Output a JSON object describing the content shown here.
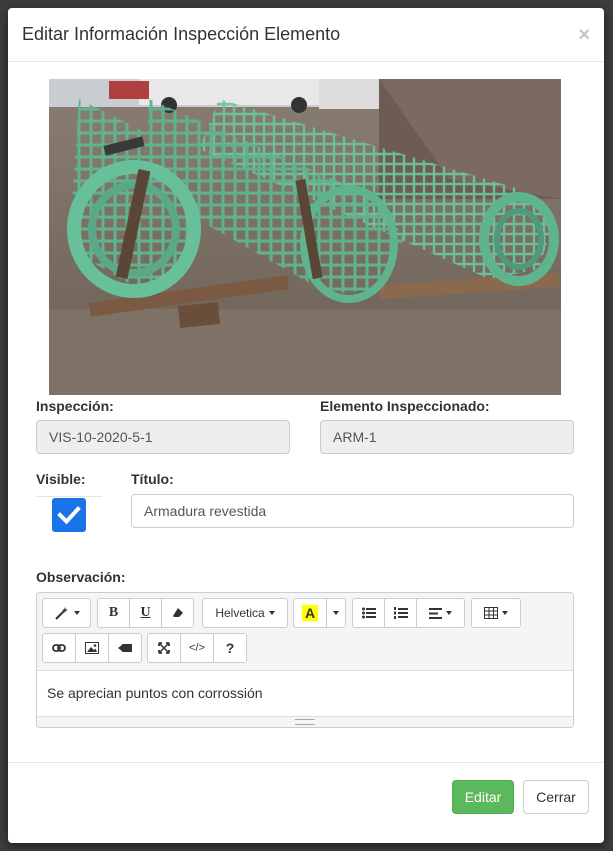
{
  "modal": {
    "title": "Editar Información Inspección Elemento",
    "close_symbol": "×"
  },
  "form": {
    "inspeccion_label": "Inspección:",
    "inspeccion_value": "VIS-10-2020-5-1",
    "elemento_label": "Elemento Inspeccionado:",
    "elemento_value": "ARM-1",
    "visible_label": "Visible:",
    "visible_checked": true,
    "titulo_label": "Título:",
    "titulo_value": "Armadura revestida",
    "observacion_label": "Observación:",
    "observacion_text": "Se aprecian puntos con corrossión"
  },
  "editor_toolbar": {
    "font_name": "Helvetica",
    "bold": "B",
    "underline": "U",
    "color_letter": "A",
    "code": "</>",
    "help": "?"
  },
  "footer": {
    "edit_label": "Editar",
    "close_label": "Cerrar"
  },
  "colors": {
    "primary_check": "#1a73e8",
    "success": "#5cb85c",
    "highlight": "#ffff00"
  }
}
